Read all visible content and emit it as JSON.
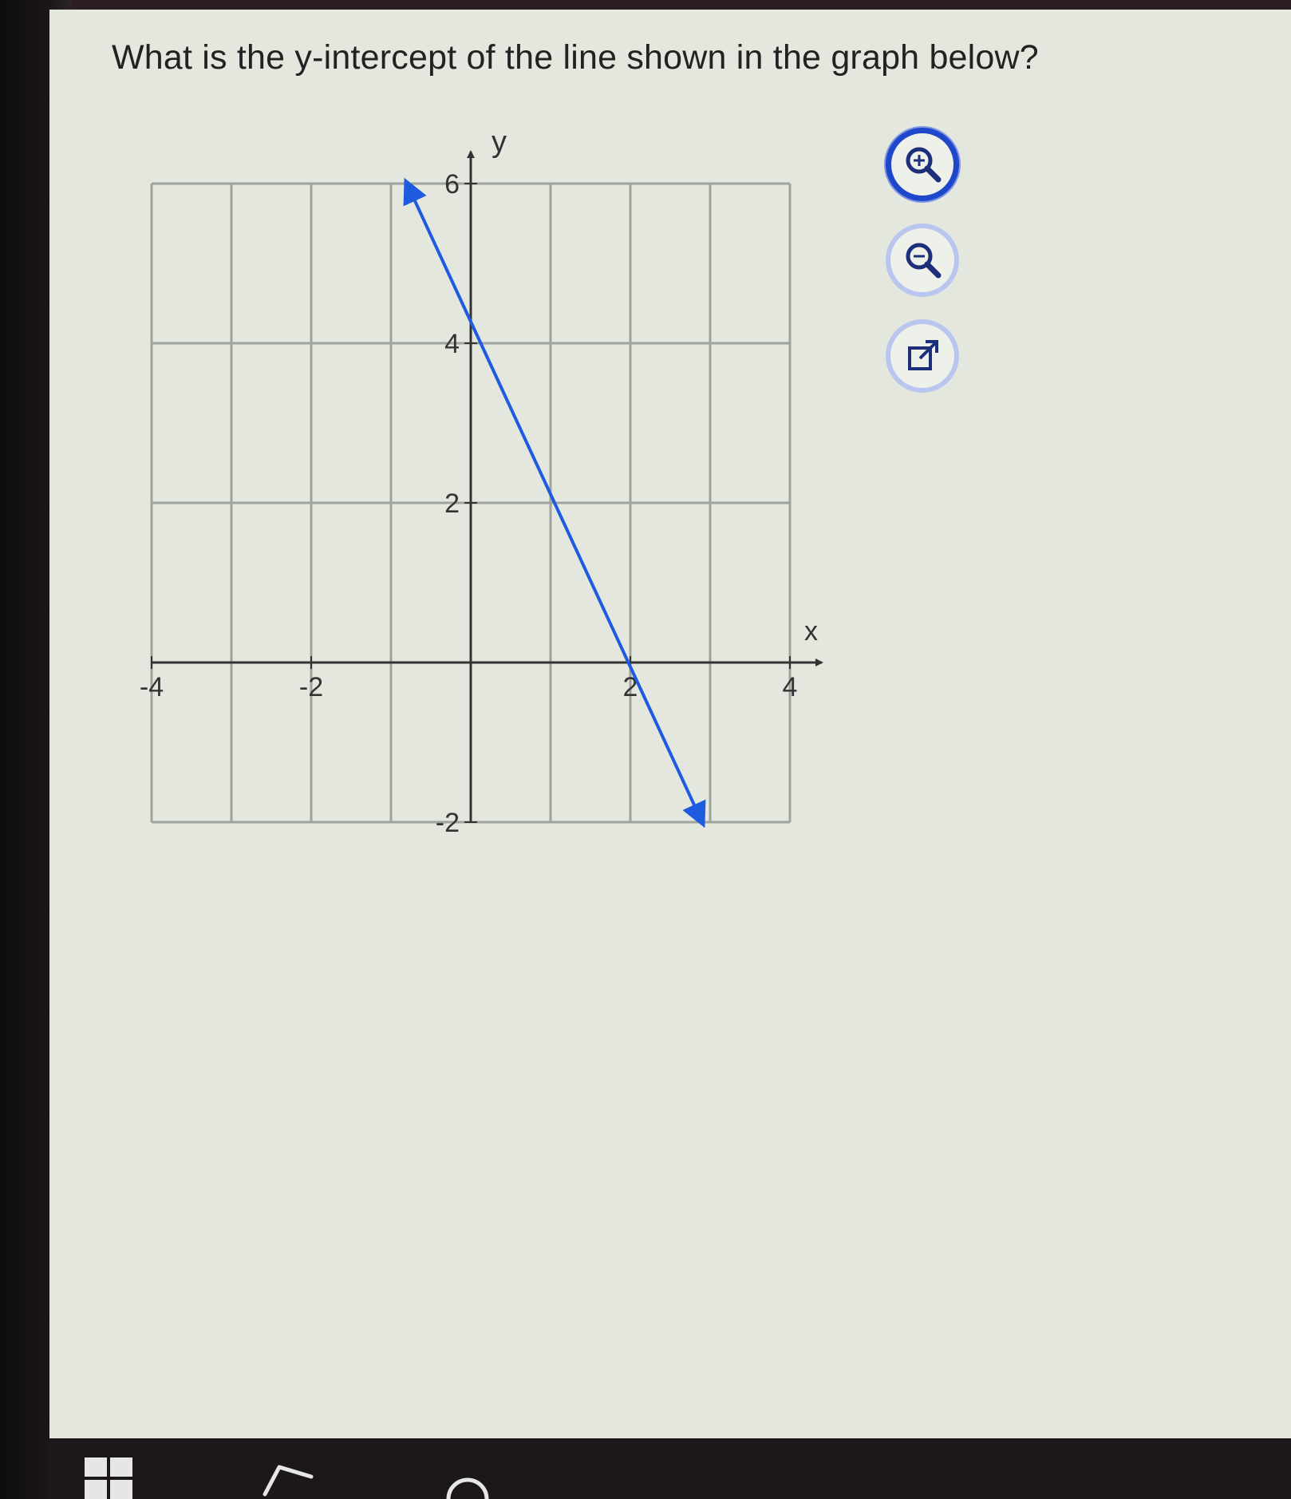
{
  "question": {
    "text": "What is the y-intercept of the line shown in the graph below?"
  },
  "chart_data": {
    "type": "line",
    "xlabel": "x",
    "ylabel": "y",
    "xlim": [
      -4,
      4
    ],
    "ylim": [
      -2,
      6
    ],
    "grid": true,
    "x_ticks": [
      -4,
      -2,
      2,
      4
    ],
    "x_tick_labels": [
      "-4",
      "-2",
      "2",
      "4"
    ],
    "y_ticks": [
      -2,
      2,
      4,
      6
    ],
    "y_tick_labels": [
      "-2",
      "2",
      "4",
      "6"
    ],
    "series": [
      {
        "x": [
          -0.8,
          2.9
        ],
        "y": [
          6,
          -2
        ],
        "arrows": "both",
        "color": "#1e5be0"
      }
    ]
  },
  "tools": {
    "zoom_in_icon": "zoom-in-icon",
    "zoom_out_icon": "zoom-out-icon",
    "popout_icon": "external-link-icon"
  },
  "taskbar": {
    "start_icon": "windows-logo-icon",
    "back_icon": "back-arrow-icon",
    "search_icon": "search-circle-icon"
  },
  "colors": {
    "page_background": "#e4e7de",
    "grid": "#9ea39c",
    "line": "#1e5be0",
    "tool_ring_active": "#1f47c9",
    "tool_ring": "#b9c6ef"
  }
}
